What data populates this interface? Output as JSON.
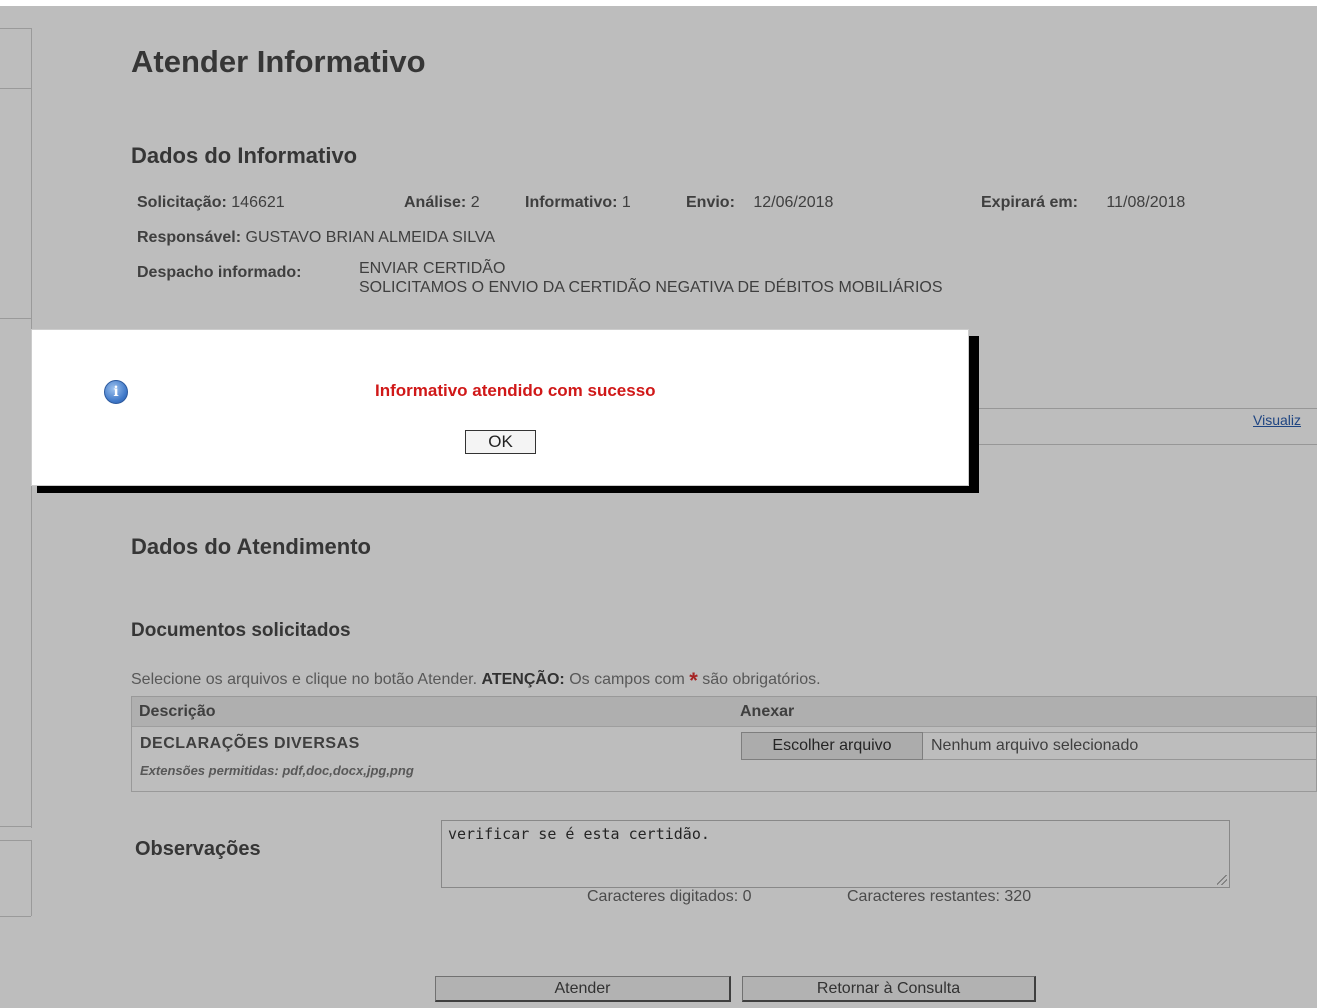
{
  "page": {
    "title": "Atender Informativo"
  },
  "informativo": {
    "section_title": "Dados do Informativo",
    "solicitacao_label": "Solicitação:",
    "solicitacao_value": "146621",
    "analise_label": "Análise:",
    "analise_value": "2",
    "informativo_label": "Informativo:",
    "informativo_value": "1",
    "envio_label": "Envio:",
    "envio_value": "12/06/2018",
    "expira_label": "Expirará em:",
    "expira_value": "11/08/2018",
    "responsavel_label": "Responsável:",
    "responsavel_value": "GUSTAVO BRIAN ALMEIDA SILVA",
    "despacho_label": "Despacho informado:",
    "despacho_line1": "ENVIAR CERTIDÃO",
    "despacho_line2": "SOLICITAMOS O ENVIO DA CERTIDÃO NEGATIVA DE DÉBITOS MOBILIÁRIOS",
    "visualizar_link": "Visualiz"
  },
  "atendimento": {
    "section_title": "Dados do Atendimento",
    "documentos_title": "Documentos solicitados",
    "hint_prefix": "Selecione os arquivos e clique no botão Atender.",
    "hint_attention": "ATENÇÃO:",
    "hint_middle": "Os campos com",
    "hint_star": "*",
    "hint_suffix": "são obrigatórios.",
    "table": {
      "col_descricao": "Descrição",
      "col_anexar": "Anexar",
      "rows": [
        {
          "descricao": "DECLARAÇÕES DIVERSAS",
          "extensoes": "Extensões permitidas: pdf,doc,docx,jpg,png",
          "file_button": "Escolher arquivo",
          "file_status": "Nenhum arquivo selecionado"
        }
      ]
    },
    "observacoes_label": "Observações",
    "observacoes_value": "verificar se é esta certidão.",
    "counter_typed": "Caracteres digitados: 0",
    "counter_remaining": "Caracteres restantes: 320",
    "atender_button": "Atender",
    "retornar_button": "Retornar à Consulta"
  },
  "dialog": {
    "icon": "info-icon",
    "message": "Informativo atendido com sucesso",
    "ok_button": "OK",
    "message_color": "#d01818"
  }
}
